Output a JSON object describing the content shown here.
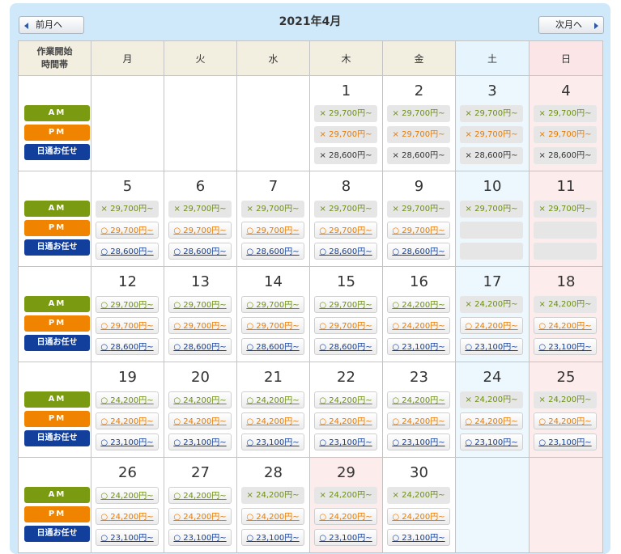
{
  "calendar": {
    "title": "2021年4月",
    "prev_label": "前月へ",
    "next_label": "次月へ",
    "corner_label_line1": "作業開始",
    "corner_label_line2": "時間帯",
    "weekdays": [
      "月",
      "火",
      "水",
      "木",
      "金",
      "土",
      "日"
    ],
    "slot_labels": {
      "am": "AM",
      "pm": "PM",
      "free": "日通お任せ"
    },
    "weeks": [
      [
        null,
        null,
        null,
        {
          "day": "1",
          "am": {
            "mark": "×",
            "price": "29,700円~"
          },
          "pm": {
            "mark": "×",
            "price": "29,700円~"
          },
          "free": {
            "mark": "×",
            "price": "28,600円~"
          }
        },
        {
          "day": "2",
          "am": {
            "mark": "×",
            "price": "29,700円~"
          },
          "pm": {
            "mark": "×",
            "price": "29,700円~"
          },
          "free": {
            "mark": "×",
            "price": "28,600円~"
          }
        },
        {
          "day": "3",
          "am": {
            "mark": "×",
            "price": "29,700円~"
          },
          "pm": {
            "mark": "×",
            "price": "29,700円~"
          },
          "free": {
            "mark": "×",
            "price": "28,600円~"
          }
        },
        {
          "day": "4",
          "am": {
            "mark": "×",
            "price": "29,700円~"
          },
          "pm": {
            "mark": "×",
            "price": "29,700円~"
          },
          "free": {
            "mark": "×",
            "price": "28,600円~"
          }
        }
      ],
      [
        {
          "day": "5",
          "am": {
            "mark": "×",
            "price": "29,700円~"
          },
          "pm": {
            "mark": "○",
            "price": "29,700円~"
          },
          "free": {
            "mark": "○",
            "price": "28,600円~"
          }
        },
        {
          "day": "6",
          "am": {
            "mark": "×",
            "price": "29,700円~"
          },
          "pm": {
            "mark": "○",
            "price": "29,700円~"
          },
          "free": {
            "mark": "○",
            "price": "28,600円~"
          }
        },
        {
          "day": "7",
          "am": {
            "mark": "×",
            "price": "29,700円~"
          },
          "pm": {
            "mark": "○",
            "price": "29,700円~"
          },
          "free": {
            "mark": "○",
            "price": "28,600円~"
          }
        },
        {
          "day": "8",
          "am": {
            "mark": "×",
            "price": "29,700円~"
          },
          "pm": {
            "mark": "○",
            "price": "29,700円~"
          },
          "free": {
            "mark": "○",
            "price": "28,600円~"
          }
        },
        {
          "day": "9",
          "am": {
            "mark": "×",
            "price": "29,700円~"
          },
          "pm": {
            "mark": "○",
            "price": "29,700円~"
          },
          "free": {
            "mark": "○",
            "price": "28,600円~"
          }
        },
        {
          "day": "10",
          "am": {
            "mark": "×",
            "price": "29,700円~"
          },
          "pm": null,
          "free": null
        },
        {
          "day": "11",
          "am": {
            "mark": "×",
            "price": "29,700円~"
          },
          "pm": null,
          "free": null
        }
      ],
      [
        {
          "day": "12",
          "am": {
            "mark": "○",
            "price": "29,700円~"
          },
          "pm": {
            "mark": "○",
            "price": "29,700円~"
          },
          "free": {
            "mark": "○",
            "price": "28,600円~"
          }
        },
        {
          "day": "13",
          "am": {
            "mark": "○",
            "price": "29,700円~"
          },
          "pm": {
            "mark": "○",
            "price": "29,700円~"
          },
          "free": {
            "mark": "○",
            "price": "28,600円~"
          }
        },
        {
          "day": "14",
          "am": {
            "mark": "○",
            "price": "29,700円~"
          },
          "pm": {
            "mark": "○",
            "price": "29,700円~"
          },
          "free": {
            "mark": "○",
            "price": "28,600円~"
          }
        },
        {
          "day": "15",
          "am": {
            "mark": "○",
            "price": "29,700円~"
          },
          "pm": {
            "mark": "○",
            "price": "29,700円~"
          },
          "free": {
            "mark": "○",
            "price": "28,600円~"
          }
        },
        {
          "day": "16",
          "am": {
            "mark": "○",
            "price": "24,200円~"
          },
          "pm": {
            "mark": "○",
            "price": "24,200円~"
          },
          "free": {
            "mark": "○",
            "price": "23,100円~"
          }
        },
        {
          "day": "17",
          "am": {
            "mark": "×",
            "price": "24,200円~"
          },
          "pm": {
            "mark": "○",
            "price": "24,200円~"
          },
          "free": {
            "mark": "○",
            "price": "23,100円~"
          }
        },
        {
          "day": "18",
          "am": {
            "mark": "×",
            "price": "24,200円~"
          },
          "pm": {
            "mark": "○",
            "price": "24,200円~"
          },
          "free": {
            "mark": "○",
            "price": "23,100円~"
          }
        }
      ],
      [
        {
          "day": "19",
          "am": {
            "mark": "○",
            "price": "24,200円~"
          },
          "pm": {
            "mark": "○",
            "price": "24,200円~"
          },
          "free": {
            "mark": "○",
            "price": "23,100円~"
          }
        },
        {
          "day": "20",
          "am": {
            "mark": "○",
            "price": "24,200円~"
          },
          "pm": {
            "mark": "○",
            "price": "24,200円~"
          },
          "free": {
            "mark": "○",
            "price": "23,100円~"
          }
        },
        {
          "day": "21",
          "am": {
            "mark": "○",
            "price": "24,200円~"
          },
          "pm": {
            "mark": "○",
            "price": "24,200円~"
          },
          "free": {
            "mark": "○",
            "price": "23,100円~"
          }
        },
        {
          "day": "22",
          "am": {
            "mark": "○",
            "price": "24,200円~"
          },
          "pm": {
            "mark": "○",
            "price": "24,200円~"
          },
          "free": {
            "mark": "○",
            "price": "23,100円~"
          }
        },
        {
          "day": "23",
          "am": {
            "mark": "○",
            "price": "24,200円~"
          },
          "pm": {
            "mark": "○",
            "price": "24,200円~"
          },
          "free": {
            "mark": "○",
            "price": "23,100円~"
          }
        },
        {
          "day": "24",
          "am": {
            "mark": "×",
            "price": "24,200円~"
          },
          "pm": {
            "mark": "○",
            "price": "24,200円~"
          },
          "free": {
            "mark": "○",
            "price": "23,100円~"
          }
        },
        {
          "day": "25",
          "am": {
            "mark": "×",
            "price": "24,200円~"
          },
          "pm": {
            "mark": "○",
            "price": "24,200円~"
          },
          "free": {
            "mark": "○",
            "price": "23,100円~"
          }
        }
      ],
      [
        {
          "day": "26",
          "am": {
            "mark": "○",
            "price": "24,200円~"
          },
          "pm": {
            "mark": "○",
            "price": "24,200円~"
          },
          "free": {
            "mark": "○",
            "price": "23,100円~"
          }
        },
        {
          "day": "27",
          "am": {
            "mark": "○",
            "price": "24,200円~"
          },
          "pm": {
            "mark": "○",
            "price": "24,200円~"
          },
          "free": {
            "mark": "○",
            "price": "23,100円~"
          }
        },
        {
          "day": "28",
          "am": {
            "mark": "×",
            "price": "24,200円~"
          },
          "pm": {
            "mark": "○",
            "price": "24,200円~"
          },
          "free": {
            "mark": "○",
            "price": "23,100円~"
          }
        },
        {
          "day": "29",
          "holiday": true,
          "am": {
            "mark": "×",
            "price": "24,200円~"
          },
          "pm": {
            "mark": "○",
            "price": "24,200円~"
          },
          "free": {
            "mark": "○",
            "price": "23,100円~"
          }
        },
        {
          "day": "30",
          "am": {
            "mark": "×",
            "price": "24,200円~"
          },
          "pm": {
            "mark": "○",
            "price": "24,200円~"
          },
          "free": {
            "mark": "○",
            "price": "23,100円~"
          }
        },
        null,
        null
      ]
    ]
  },
  "colors": {
    "am": "#7a9a12",
    "pm": "#f08300",
    "free": "#123f9c",
    "saturday_bg": "#ecf8fe",
    "sunday_bg": "#fdecec",
    "frame_bg": "#cfe9fa"
  },
  "icons": {
    "prev": "triangle-left-icon",
    "next": "triangle-right-icon"
  }
}
